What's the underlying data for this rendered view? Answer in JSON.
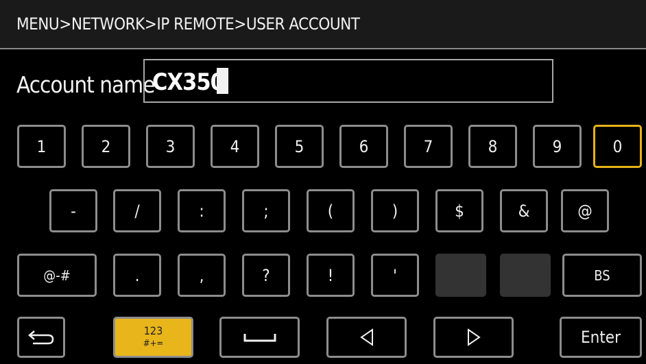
{
  "header": {
    "breadcrumb": "MENU>NETWORK>IP REMOTE>USER ACCOUNT"
  },
  "account": {
    "label": "Account name",
    "value": "CX350"
  },
  "keyboard": {
    "row1": [
      "1",
      "2",
      "3",
      "4",
      "5",
      "6",
      "7",
      "8",
      "9",
      "0"
    ],
    "row2": [
      "-",
      "/",
      ":",
      ";",
      "(",
      ")",
      "$",
      "&",
      "@"
    ],
    "row3": [
      "@-#",
      ".",
      ",",
      "?",
      "!",
      "'",
      "",
      "",
      "BS"
    ],
    "row4": {
      "mode_top": "123",
      "mode_bottom": "#+=",
      "enter": "Enter"
    }
  },
  "colors": {
    "focus": "#e6b419",
    "accent_key": "#e8b51a",
    "border": "#8d8d8d"
  },
  "icons": {
    "back": "return-arrow-icon",
    "space": "space-bar-icon",
    "left": "triangle-left-icon",
    "right": "triangle-right-icon"
  }
}
